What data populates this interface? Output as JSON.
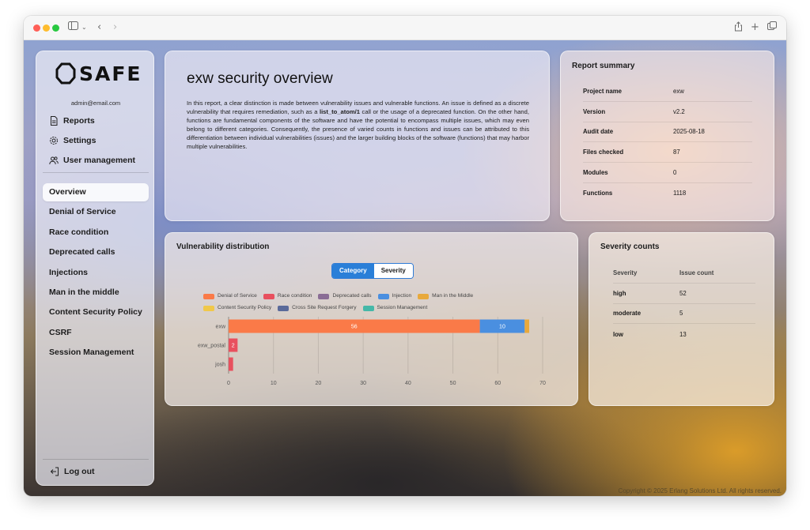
{
  "brand": {
    "name": "SAFE",
    "user_email": "admin@email.com"
  },
  "nav_top": [
    {
      "label": "Reports",
      "icon": "document-icon"
    },
    {
      "label": "Settings",
      "icon": "gear-icon"
    },
    {
      "label": "User management",
      "icon": "users-icon"
    }
  ],
  "nav_list": [
    {
      "label": "Overview",
      "active": true
    },
    {
      "label": "Denial of Service"
    },
    {
      "label": "Race condition"
    },
    {
      "label": "Deprecated calls"
    },
    {
      "label": "Injections"
    },
    {
      "label": "Man in the middle"
    },
    {
      "label": "Content Security Policy"
    },
    {
      "label": "CSRF"
    },
    {
      "label": "Session Management"
    }
  ],
  "logout_label": "Log out",
  "overview": {
    "title": "exw security overview",
    "para_before": "In this report, a clear distinction is made between vulnerability issues and vulnerable functions. An issue is defined as a discrete vulnerability that requires remediation, such as a ",
    "para_code": "list_to_atom/1",
    "para_after": " call or the usage of a deprecated function. On the other hand, functions are fundamental components of the software and have the potential to encompass multiple issues, which may even belong to different categories. Consequently, the presence of varied counts in functions and issues can be attributed to this differentiation between individual vulnerabilities (issues) and the larger building blocks of the software (functions) that may harbor multiple vulnerabilities."
  },
  "summary": {
    "title": "Report summary",
    "rows": [
      {
        "k": "Project name",
        "v": "exw"
      },
      {
        "k": "Version",
        "v": "v2.2"
      },
      {
        "k": "Audit date",
        "v": "2025-08-18"
      },
      {
        "k": "Files checked",
        "v": "87"
      },
      {
        "k": "Modules",
        "v": "0"
      },
      {
        "k": "Functions",
        "v": "1118"
      }
    ]
  },
  "distribution": {
    "title": "Vulnerability distribution",
    "toggle": [
      "Category",
      "Severity"
    ]
  },
  "chart_data": {
    "type": "bar",
    "orientation": "horizontal",
    "stacked": true,
    "categories": [
      "exw",
      "exw_postal",
      "josh"
    ],
    "series": [
      {
        "name": "Denial of Service",
        "color": "#fa7a48",
        "values": [
          56,
          0,
          0
        ]
      },
      {
        "name": "Race condition",
        "color": "#e8505e",
        "values": [
          0,
          2,
          1
        ]
      },
      {
        "name": "Deprecated calls",
        "color": "#8a6d95",
        "values": [
          0,
          0,
          0
        ]
      },
      {
        "name": "Injection",
        "color": "#4a8fe0",
        "values": [
          10,
          0,
          0
        ]
      },
      {
        "name": "Man in the Middle",
        "color": "#e8a93c",
        "values": [
          1,
          0,
          0
        ]
      },
      {
        "name": "Content Security Policy",
        "color": "#f0c84a",
        "values": [
          0,
          0,
          0
        ]
      },
      {
        "name": "Cross Site Request Forgery",
        "color": "#5a6a9a",
        "values": [
          0,
          0,
          0
        ]
      },
      {
        "name": "Session Management",
        "color": "#45b8a8",
        "values": [
          0,
          0,
          0
        ]
      }
    ],
    "xlim": [
      0,
      70
    ],
    "xticks": [
      0,
      10,
      20,
      30,
      40,
      50,
      60,
      70
    ],
    "grid": true,
    "legend": "top"
  },
  "severity": {
    "title": "Severity counts",
    "headers": [
      "Severity",
      "Issue count"
    ],
    "rows": [
      {
        "k": "high",
        "v": "52"
      },
      {
        "k": "moderate",
        "v": "5"
      },
      {
        "k": "low",
        "v": "13"
      }
    ]
  },
  "footer": "Copyright © 2025 Erlang Solutions Ltd. All rights reserved."
}
